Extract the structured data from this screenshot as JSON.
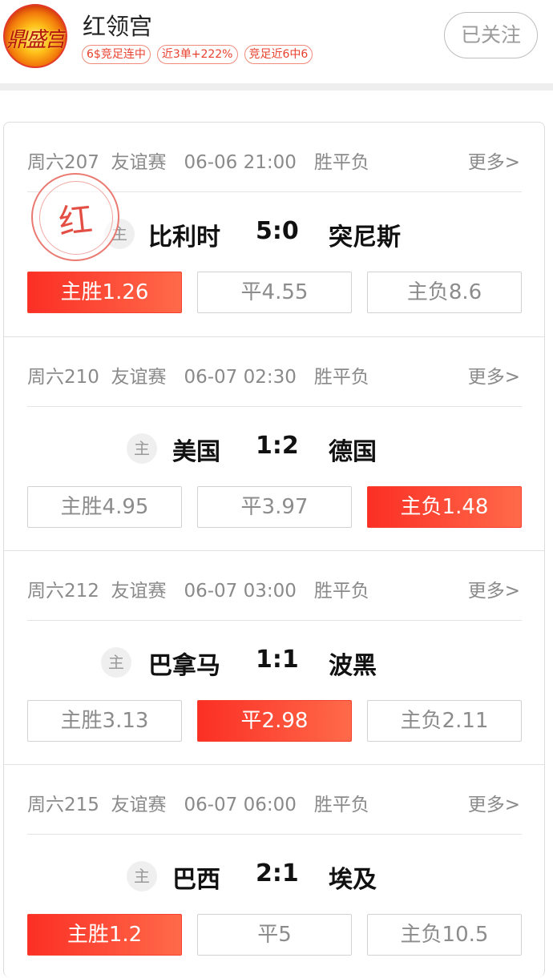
{
  "header": {
    "avatar_text": "鼎盛宫",
    "name": "红领宫",
    "tags": [
      "6$竞足连中",
      "近3单+222%",
      "竞足近6中6"
    ],
    "follow_label": "已关注"
  },
  "matches": [
    {
      "meta": "周六207  友谊赛   06-06 21:00   胜平负",
      "more": "更多>",
      "home_badge": "主",
      "home": "比利时",
      "score": "5:0",
      "away": "突尼斯",
      "odds": [
        "主胜1.26",
        "平4.55",
        "主负8.6"
      ],
      "selected": 0,
      "seal": "红"
    },
    {
      "meta": "周六210  友谊赛   06-07 02:30   胜平负",
      "more": "更多>",
      "home_badge": "主",
      "home": "美国",
      "score": "1:2",
      "away": "德国",
      "odds": [
        "主胜4.95",
        "平3.97",
        "主负1.48"
      ],
      "selected": 2
    },
    {
      "meta": "周六212  友谊赛   06-07 03:00   胜平负",
      "more": "更多>",
      "home_badge": "主",
      "home": "巴拿马",
      "score": "1:1",
      "away": "波黑",
      "odds": [
        "主胜3.13",
        "平2.98",
        "主负2.11"
      ],
      "selected": 1
    },
    {
      "meta": "周六215  友谊赛   06-07 06:00   胜平负",
      "more": "更多>",
      "home_badge": "主",
      "home": "巴西",
      "score": "2:1",
      "away": "埃及",
      "odds": [
        "主胜1.2",
        "平5",
        "主负10.5"
      ],
      "selected": 0
    }
  ],
  "colors": {
    "accent": "#fb2f25",
    "accent_light": "#ff6a4a",
    "tag_text": "#e8412e",
    "muted_text": "#8a8a8a"
  }
}
